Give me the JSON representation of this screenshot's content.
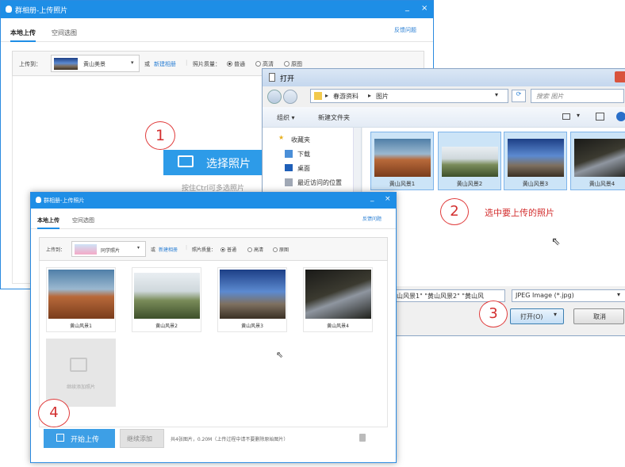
{
  "back_window": {
    "title": "群相册-上传照片",
    "minimize": "_",
    "close": "×",
    "tabs": [
      "本地上传",
      "空间选图"
    ],
    "feedback": "反馈问题",
    "upload_to_label": "上传到：",
    "album_name": "黄山美景",
    "or_label": "或",
    "new_album": "新建相册",
    "quality_label": "照片质量：",
    "quality_options": [
      "普通",
      "高清",
      "原图"
    ],
    "select_photos_button": "选择照片",
    "select_hint": "按住Ctrl可多选照片"
  },
  "open_dialog": {
    "title": "打开",
    "breadcrumb": [
      "春游资料",
      "图片"
    ],
    "search_placeholder": "搜索 图片",
    "organize": "组织 ▾",
    "new_folder": "新建文件夹",
    "nav_items": [
      "收藏夹",
      "下载",
      "桌面",
      "最近访问的位置"
    ],
    "files": [
      "黄山风景1",
      "黄山风景2",
      "黄山风景3",
      "黄山风景4"
    ],
    "filename_value": "山风景1\" \"黄山风景2\" \"黄山风",
    "filetype": "JPEG Image (*.jpg)",
    "open_button": "打开(O)",
    "cancel_button": "取消"
  },
  "front_window": {
    "title": "群相册-上传照片",
    "minimize": "_",
    "close": "×",
    "tabs": [
      "本地上传",
      "空间选图"
    ],
    "feedback": "反馈问题",
    "upload_to_label": "上传到：",
    "album_name": "同学照片",
    "or_label": "或",
    "new_album": "新建相册",
    "quality_label": "照片质量：",
    "quality_options": [
      "普通",
      "高清",
      "原图"
    ],
    "photos": [
      "黄山风景1",
      "黄山风景2",
      "黄山风景3",
      "黄山风景4"
    ],
    "add_more_tile": "继续添加照片",
    "start_upload": "开始上传",
    "continue_add": "继续添加",
    "status": "共4张图片，0.20M（上传过程中请不要删除原始图片）"
  },
  "annotations": {
    "steps": [
      "1",
      "2",
      "3",
      "4"
    ],
    "step2_text": "选中要上传的照片",
    "color": "#e03b3b"
  }
}
